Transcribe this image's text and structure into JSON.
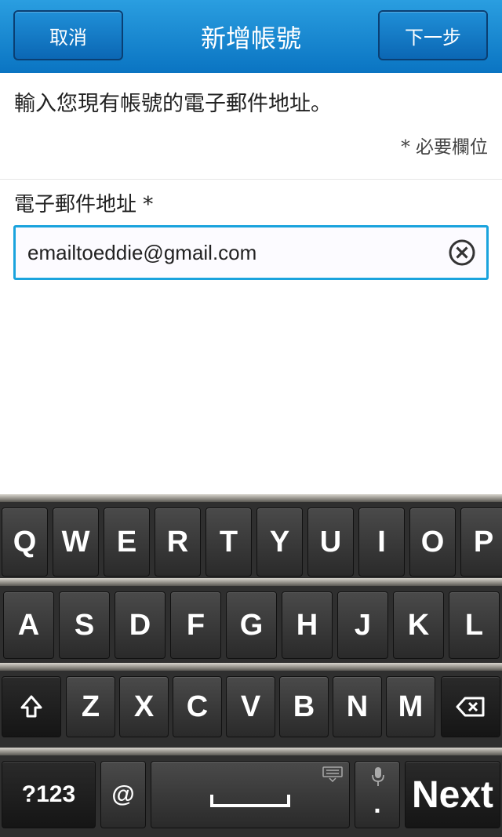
{
  "titlebar": {
    "cancel_label": "取消",
    "title": "新增帳號",
    "next_label": "下一步"
  },
  "form": {
    "instructions": "輸入您現有帳號的電子郵件地址。",
    "required_note": "* 必要欄位",
    "email_label": "電子郵件地址 *",
    "email_value": "emailtoeddie@gmail.com"
  },
  "keyboard": {
    "row1": [
      "Q",
      "W",
      "E",
      "R",
      "T",
      "Y",
      "U",
      "I",
      "O",
      "P"
    ],
    "row2": [
      "A",
      "S",
      "D",
      "F",
      "G",
      "H",
      "J",
      "K",
      "L"
    ],
    "row3": [
      "Z",
      "X",
      "C",
      "V",
      "B",
      "N",
      "M"
    ],
    "symbols_label": "?123",
    "at_label": "@",
    "period_label": ".",
    "next_label": "Next",
    "shift_icon": "shift-icon",
    "backspace_icon": "backspace-icon"
  },
  "colors": {
    "titlebar": "#0a74c2",
    "field_border": "#1aa3dd"
  }
}
